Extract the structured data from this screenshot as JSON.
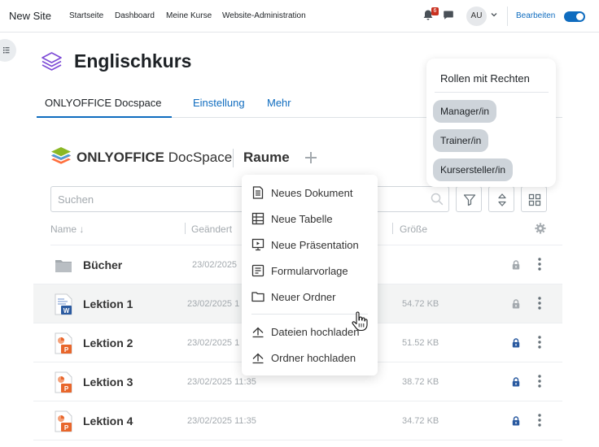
{
  "topbar": {
    "site_name": "New Site",
    "nav": [
      "Startseite",
      "Dashboard",
      "Meine Kurse",
      "Website-Administration"
    ],
    "notification_count": "6",
    "avatar_initials": "AU",
    "edit_mode_label": "Bearbeiten",
    "edit_mode_on": true
  },
  "course": {
    "title": "Englischkurs",
    "tabs": [
      {
        "label": "ONLYOFFICE Docspace",
        "active": true
      },
      {
        "label": "Einstellung",
        "active": false
      },
      {
        "label": "Mehr",
        "active": false
      }
    ]
  },
  "roles_panel": {
    "title": "Rollen mit Rechten",
    "roles": [
      "Manager/in",
      "Trainer/in",
      "Kursersteller/in"
    ]
  },
  "docspace": {
    "brand_bold": "ONLYOFFICE",
    "brand_light": "DocSpace",
    "section": "Raume",
    "search_placeholder": "Suchen",
    "columns": {
      "name": "Name",
      "modified": "Geändert",
      "size": "Größe"
    },
    "rows": [
      {
        "name": "Bücher",
        "type": "folder",
        "date": "23/02/2025",
        "size": "",
        "lock": "grey"
      },
      {
        "name": "Lektion 1",
        "type": "docx",
        "date": "23/02/2025 1",
        "size": "54.72 KB",
        "lock": "grey"
      },
      {
        "name": "Lektion 2",
        "type": "pptx",
        "date": "23/02/2025 1",
        "size": "51.52 KB",
        "lock": "blue"
      },
      {
        "name": "Lektion 3",
        "type": "pptx",
        "date": "23/02/2025 11:35",
        "size": "38.72 KB",
        "lock": "blue"
      },
      {
        "name": "Lektion 4",
        "type": "pptx",
        "date": "23/02/2025 11:35",
        "size": "34.72 KB",
        "lock": "blue"
      }
    ]
  },
  "create_menu": {
    "items": [
      "Neues Dokument",
      "Neue Tabelle",
      "Neue Präsentation",
      "Formularvorlage",
      "Neuer Ordner",
      "Dateien hochladen",
      "Ordner hochladen"
    ]
  },
  "colors": {
    "accent": "#0f6cbf",
    "docspace_blue": "#2a5aa0",
    "muted": "#a3a9ae"
  }
}
